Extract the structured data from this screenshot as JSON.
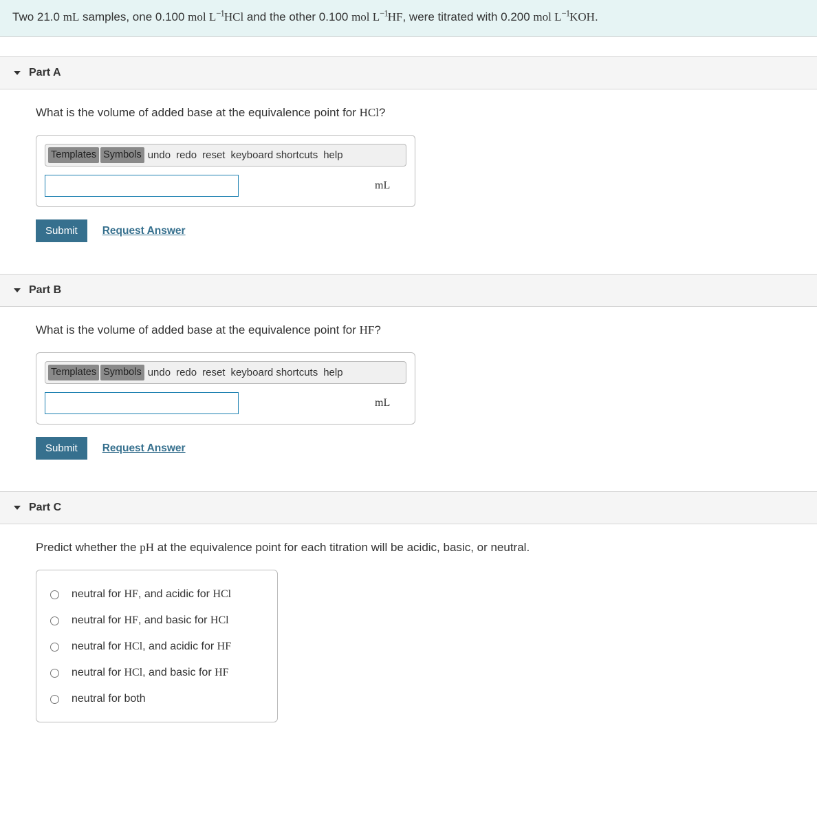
{
  "intro": {
    "t1": "Two 21.0 ",
    "mL": "mL",
    "t2": " samples, one 0.100 ",
    "molL": "mol L",
    "exp": "−1",
    "hcl": "HCl",
    "t3": " and the other 0.100 ",
    "hf": "HF",
    "t4": ", were titrated with 0.200 ",
    "koh": "KOH",
    "period": "."
  },
  "toolbar": {
    "templates": "Templates",
    "symbols": "Symbols",
    "undo": "undo",
    "redo": "redo",
    "reset": "reset",
    "keyboard": "keyboard shortcuts",
    "help": "help"
  },
  "actions": {
    "submit": "Submit",
    "request": "Request Answer"
  },
  "partA": {
    "title": "Part A",
    "q1": "What is the volume of added base at the equivalence point for ",
    "chem": "HCl",
    "qm": "?",
    "unit": "mL"
  },
  "partB": {
    "title": "Part B",
    "q1": "What is the volume of added base at the equivalence point for ",
    "chem": "HF",
    "qm": "?",
    "unit": "mL"
  },
  "partC": {
    "title": "Part C",
    "q1": "Predict whether the ",
    "ph": "pH",
    "q2": " at the equivalence point for each titration will be acidic, basic, or neutral.",
    "options": [
      {
        "pre": "neutral for ",
        "c1": "HF",
        "mid": ", and acidic for ",
        "c2": "HCl"
      },
      {
        "pre": "neutral for ",
        "c1": "HF",
        "mid": ", and basic for ",
        "c2": "HCl"
      },
      {
        "pre": "neutral for ",
        "c1": "HCl",
        "mid": ", and acidic for ",
        "c2": "HF"
      },
      {
        "pre": "neutral for ",
        "c1": "HCl",
        "mid": ", and basic for ",
        "c2": "HF"
      },
      {
        "pre": "neutral for both",
        "c1": "",
        "mid": "",
        "c2": ""
      }
    ]
  }
}
